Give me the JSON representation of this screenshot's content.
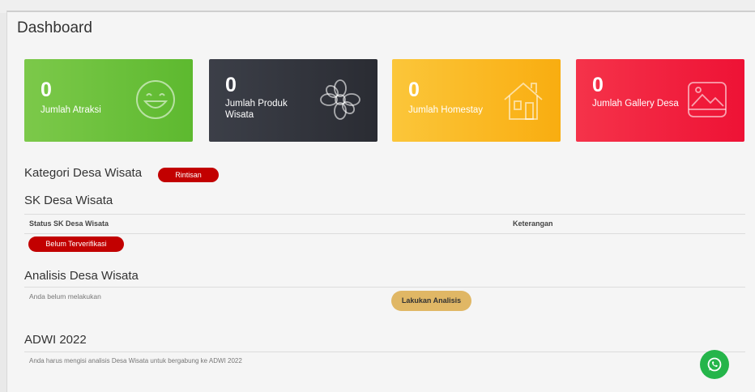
{
  "page": {
    "title": "Dashboard"
  },
  "cards": [
    {
      "count": "0",
      "label": "Jumlah Atraksi",
      "icon": "smiley-icon",
      "color": "#5db92f"
    },
    {
      "count": "0",
      "label": "Jumlah Produk Wisata",
      "icon": "flower-icon",
      "color": "#2a2c33"
    },
    {
      "count": "0",
      "label": "Jumlah Homestay",
      "icon": "house-icon",
      "color": "#f9ad10"
    },
    {
      "count": "0",
      "label": "Jumlah Gallery Desa",
      "icon": "image-icon",
      "color": "#ee1235"
    }
  ],
  "kategori": {
    "title": "Kategori Desa Wisata",
    "badge": "Rintisan"
  },
  "sk": {
    "title": "SK Desa Wisata",
    "columns": [
      "Status SK Desa Wisata",
      "Keterangan"
    ],
    "status_badge": "Belum Terverifikasi"
  },
  "analisis": {
    "title": "Analisis Desa Wisata",
    "message": "Anda belum melakukan",
    "button": "Lakukan Analisis"
  },
  "adwi": {
    "title": "ADWI 2022",
    "message": "Anda harus mengisi analisis Desa Wisata untuk bergabung ke ADWI 2022"
  },
  "colors": {
    "badge": "#c20000",
    "button": "#e0b765",
    "whatsapp": "#25b54a"
  },
  "whatsapp": {
    "icon": "whatsapp-icon"
  }
}
